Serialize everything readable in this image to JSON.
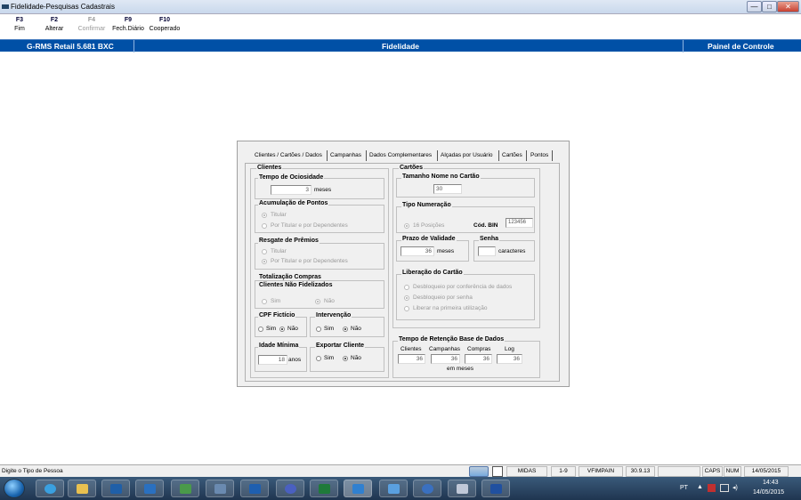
{
  "window": {
    "title": "Fidelidade-Pesquisas Cadastrais",
    "btn_min": "—",
    "btn_max": "□",
    "btn_close": "✕"
  },
  "toolbar": [
    {
      "key": "F3",
      "label": "Fim",
      "enabled": true
    },
    {
      "key": "F2",
      "label": "Alterar",
      "enabled": true
    },
    {
      "key": "F4",
      "label": "Confirmar",
      "enabled": false
    },
    {
      "key": "F9",
      "label": "Fech.Diário",
      "enabled": true
    },
    {
      "key": "F10",
      "label": "Cooperado",
      "enabled": true
    }
  ],
  "header": {
    "left": "G-RMS Retail 5.681 BXC",
    "center": "Fidelidade",
    "right": "Painel de Controle"
  },
  "tabs": [
    "Clientes / Cartões / Dados",
    "Campanhas",
    "Dados Complementares",
    "Alçadas por Usuário",
    "Cartões",
    "Pontos"
  ],
  "clientes": {
    "title": "Clientes",
    "ociosidade": {
      "title": "Tempo de Ociosidade",
      "value": "3",
      "unit": "meses"
    },
    "acumulacao": {
      "title": "Acumulação de Pontos",
      "opt1": "Titular",
      "opt2": "Por Titular e por Dependentes",
      "selected": 1
    },
    "resgate": {
      "title": "Resgate de Prêmios",
      "opt1": "Titular",
      "opt2": "Por Titular e por Dependentes",
      "selected": 2
    },
    "totalizacao": {
      "title1": "Totalização Compras",
      "title2": "Clientes Não Fidelizados",
      "opt1": "Sim",
      "opt2": "Não",
      "selected": 2
    },
    "cpf": {
      "title": "CPF Fictício",
      "opt1": "Sim",
      "opt2": "Não",
      "selected": 2
    },
    "intervencao": {
      "title": "Intervenção",
      "opt1": "Sim",
      "opt2": "Não",
      "selected": 2
    },
    "idade": {
      "title": "Idade Mínima",
      "value": "18",
      "unit": "anos"
    },
    "exportar": {
      "title": "Exportar Cliente",
      "opt1": "Sim",
      "opt2": "Não",
      "selected": 2
    }
  },
  "cartoes": {
    "title": "Cartões",
    "tamanho": {
      "title": "Tamanho Nome no Cartão",
      "value": "30"
    },
    "numeracao": {
      "title": "Tipo Numeração",
      "opt1": "16 Posições",
      "bin_label": "Cód. BIN",
      "bin_value": "123456"
    },
    "validade": {
      "title": "Prazo de Validade",
      "value": "36",
      "unit": "meses"
    },
    "senha": {
      "title": "Senha",
      "value": "",
      "unit": "caracteres"
    },
    "liberacao": {
      "title": "Liberação do Cartão",
      "opt1": "Desbloqueio por conferência de dados",
      "opt2": "Desbloqueio por senha",
      "opt3": "Liberar na primeira utilização",
      "selected": 2
    }
  },
  "retencao": {
    "title": "Tempo de Retenção Base de Dados",
    "cols": [
      "Clientes",
      "Campanhas",
      "Compras",
      "Log"
    ],
    "values": [
      "36",
      "36",
      "36",
      "36"
    ],
    "unit": "em meses"
  },
  "status": {
    "message": "Digite o Tipo de Pessoa",
    "cells": [
      "MIDAS",
      "1-9",
      "VFIMPAIN",
      "30.9.13",
      "",
      "CAPS",
      "NUM",
      "14/05/2015"
    ]
  },
  "taskbar": {
    "lang": "PT",
    "time": "14:43",
    "date": "14/05/2015"
  }
}
